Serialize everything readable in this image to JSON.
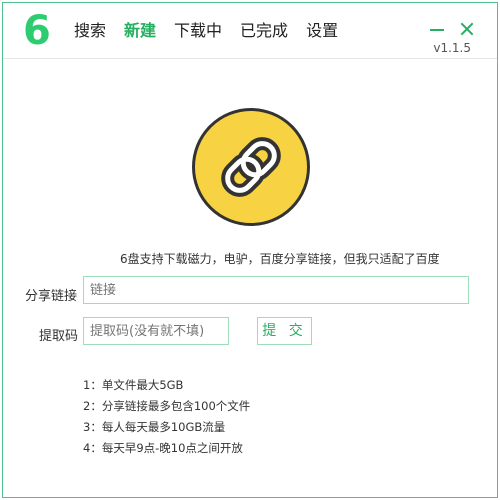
{
  "app": {
    "logo_text": "6",
    "version": "v1.1.5"
  },
  "nav": {
    "items": [
      {
        "label": "搜索",
        "active": false
      },
      {
        "label": "新建",
        "active": true
      },
      {
        "label": "下载中",
        "active": false
      },
      {
        "label": "已完成",
        "active": false
      },
      {
        "label": "设置",
        "active": false
      }
    ]
  },
  "window_controls": {
    "minimize_icon": "minimize-icon",
    "close_icon": "close-icon"
  },
  "main": {
    "badge_icon": "link-chain-icon",
    "description": "6盘支持下载磁力，电驴，百度分享链接，但我只适配了百度",
    "share_link": {
      "label": "分享链接",
      "placeholder": "链接",
      "value": ""
    },
    "extract_code": {
      "label": "提取码",
      "placeholder": "提取码(没有就不填)",
      "value": ""
    },
    "submit_label": "提 交",
    "notes": [
      "1：单文件最大5GB",
      "2：分享链接最多包含100个文件",
      "3：每人每天最多10GB流量",
      "4：每天早9点-晚10点之间开放"
    ]
  },
  "colors": {
    "accent": "#27ae60",
    "badge": "#f7d343",
    "border": "#9fdcb8"
  }
}
